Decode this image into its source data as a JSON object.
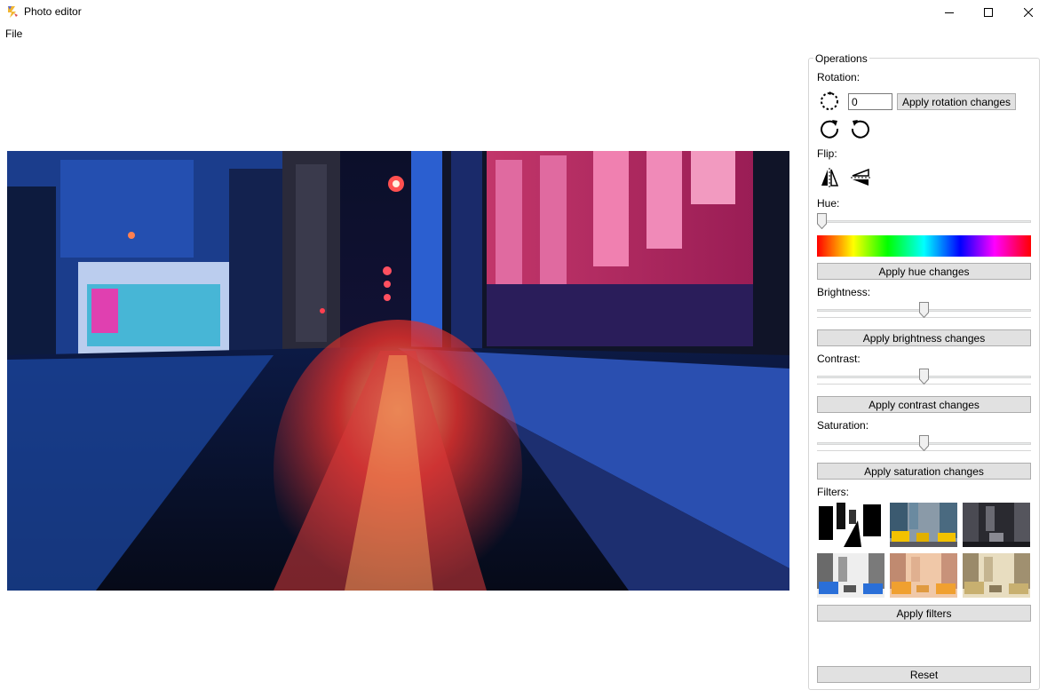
{
  "window": {
    "title": "Photo editor"
  },
  "menu": {
    "file": "File"
  },
  "operations": {
    "legend": "Operations",
    "rotation": {
      "label": "Rotation:",
      "angle_value": "0",
      "apply": "Apply rotation changes"
    },
    "flip": {
      "label": "Flip:"
    },
    "hue": {
      "label": "Hue:",
      "slider_fraction": 0.0,
      "apply": "Apply hue changes"
    },
    "brightness": {
      "label": "Brightness:",
      "slider_fraction": 0.5,
      "apply": "Apply brightness changes"
    },
    "contrast": {
      "label": "Contrast:",
      "slider_fraction": 0.5,
      "apply": "Apply contrast changes"
    },
    "saturation": {
      "label": "Saturation:",
      "slider_fraction": 0.5,
      "apply": "Apply saturation changes"
    },
    "filters": {
      "label": "Filters:",
      "apply": "Apply filters"
    },
    "reset": "Reset"
  },
  "icons": {
    "app": "app-icon",
    "rotate_custom": "dashed-rotate-icon",
    "rotate_cw": "rotate-clockwise-icon",
    "rotate_ccw": "rotate-counterclockwise-icon",
    "flip_h": "flip-horizontal-icon",
    "flip_v": "flip-vertical-icon"
  }
}
